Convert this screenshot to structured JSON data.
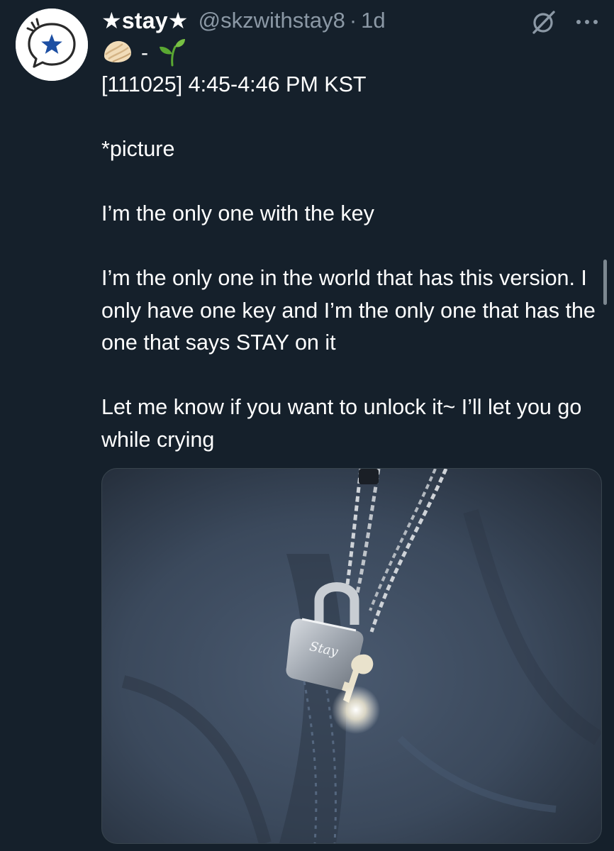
{
  "post": {
    "display_name": "★stay★",
    "handle": "@skzwithstay8",
    "separator": "·",
    "time_ago": "1d",
    "bio_separator": "-",
    "bio_icons": [
      "dumpling-icon",
      "sprout-icon"
    ],
    "lines": [
      "[111025] 4:45-4:46 PM KST",
      "",
      "*picture",
      "",
      "I’m the only one with the key",
      "",
      "I’m the only one in the world that has this version. I only have one key and I’m the only one that has the one that says STAY on it",
      "",
      "Let me know if you want to unlock it~ I’ll let you go while crying"
    ],
    "media": {
      "description_icon": "padlock-photo",
      "lock_engraving": "Stay"
    }
  },
  "icons": {
    "avatar": "star-badge-icon",
    "grok": "grok-icon",
    "more": "more-icon"
  },
  "colors": {
    "background": "#15202b",
    "text": "#ffffff",
    "muted": "#8b98a5",
    "avatar_star": "#1d4fa3"
  }
}
